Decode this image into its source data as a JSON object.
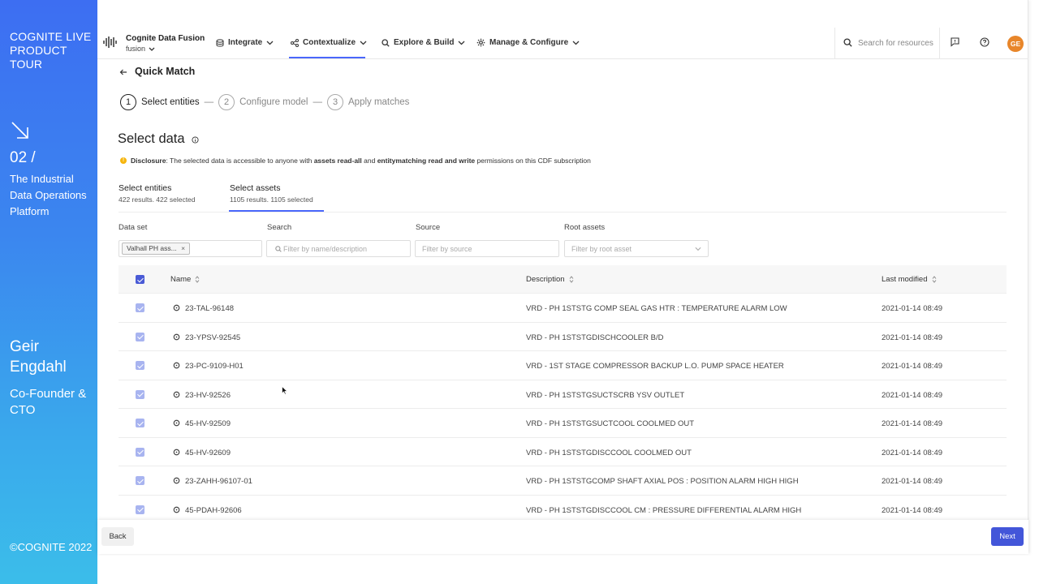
{
  "side": {
    "brand": "COGNITE LIVE PRODUCT TOUR",
    "section_num": "02 /",
    "platform": "The Industrial Data Operations Platform",
    "person": "Geir Engdahl",
    "role": "Co-Founder & CTO",
    "copyright": "©COGNITE 2022"
  },
  "topnav": {
    "app_name": "Cognite Data Fusion",
    "app_sub": "fusion",
    "items": [
      {
        "label": "Integrate",
        "icon": "database-icon"
      },
      {
        "label": "Contextualize",
        "icon": "share-icon"
      },
      {
        "label": "Explore & Build",
        "icon": "search-icon"
      },
      {
        "label": "Manage & Configure",
        "icon": "gear-icon"
      }
    ],
    "active_item": "Contextualize",
    "search_placeholder": "Search for resources",
    "avatar": "GE"
  },
  "page": {
    "title": "Quick Match",
    "steps": [
      {
        "num": "1",
        "label": "Select entities"
      },
      {
        "num": "2",
        "label": "Configure model"
      },
      {
        "num": "3",
        "label": "Apply matches"
      }
    ],
    "section_title": "Select data",
    "disclosure": {
      "bold": "Disclosure",
      "t1": ": The selected data is accessible to anyone with ",
      "b1": "assets read-all",
      "t2": " and ",
      "b2": "entitymatching read and write",
      "t3": " permissions on this CDF subscription"
    },
    "tabs": [
      {
        "label": "Select entities",
        "sub": "422 results. 422 selected"
      },
      {
        "label": "Select assets",
        "sub": "1105 results. 1105 selected"
      }
    ]
  },
  "filters": {
    "dataset_label": "Data set",
    "dataset_chip": "Valhall PH ass...",
    "search_label": "Search",
    "search_placeholder": "Filter by name/description",
    "source_label": "Source",
    "source_placeholder": "Filter by source",
    "root_label": "Root assets",
    "root_placeholder": "Filter by root asset"
  },
  "table": {
    "columns": [
      "Name",
      "Description",
      "Last modified"
    ],
    "rows": [
      {
        "name": "23-TAL-96148",
        "description": "VRD - PH 1STSTG COMP SEAL GAS HTR : TEMPERATURE ALARM LOW",
        "modified": "2021-01-14 08:49"
      },
      {
        "name": "23-YPSV-92545",
        "description": "VRD - PH 1STSTGDISCHCOOLER B/D",
        "modified": "2021-01-14 08:49"
      },
      {
        "name": "23-PC-9109-H01",
        "description": "VRD - 1ST STAGE COMPRESSOR BACKUP L.O. PUMP SPACE HEATER",
        "modified": "2021-01-14 08:49"
      },
      {
        "name": "23-HV-92526",
        "description": "VRD - PH 1STSTGSUCTSCRB YSV OUTLET",
        "modified": "2021-01-14 08:49"
      },
      {
        "name": "45-HV-92509",
        "description": "VRD - PH 1STSTGSUCTCOOL COOLMED OUT",
        "modified": "2021-01-14 08:49"
      },
      {
        "name": "45-HV-92609",
        "description": "VRD - PH 1STSTGDISCCOOL COOLMED OUT",
        "modified": "2021-01-14 08:49"
      },
      {
        "name": "23-ZAHH-96107-01",
        "description": "VRD - PH 1STSTGCOMP SHAFT AXIAL POS : POSITION ALARM HIGH HIGH",
        "modified": "2021-01-14 08:49"
      },
      {
        "name": "45-PDAH-92606",
        "description": "VRD - PH 1STSTGDISCCOOL CM : PRESSURE DIFFERENTIAL ALARM HIGH",
        "modified": "2021-01-14 08:49"
      }
    ]
  },
  "footer": {
    "back": "Back",
    "next": "Next"
  },
  "colors": {
    "accent": "#4a67fb",
    "primary_button": "#4356d9",
    "avatar": "#e8862a",
    "warning": "#f6b50d"
  }
}
